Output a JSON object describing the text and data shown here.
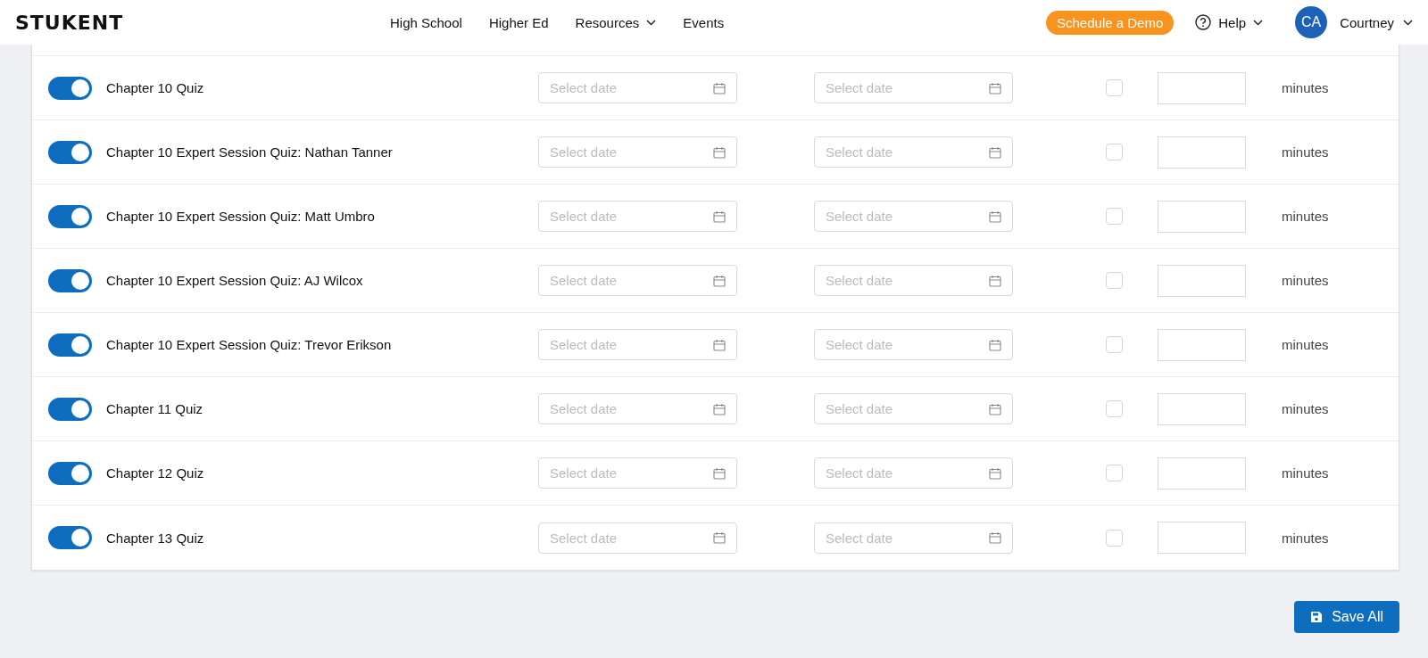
{
  "header": {
    "logo": "STUKENT",
    "nav": [
      {
        "label": "High School",
        "dropdown": false
      },
      {
        "label": "Higher Ed",
        "dropdown": false
      },
      {
        "label": "Resources",
        "dropdown": true
      },
      {
        "label": "Events",
        "dropdown": false
      }
    ],
    "demo_button": "Schedule a Demo",
    "help": "Help",
    "user": {
      "initials": "CA",
      "name": "Courtney"
    }
  },
  "rows": [
    {
      "title": "Chapter 10 Quiz",
      "on": true,
      "start_placeholder": "Select date",
      "end_placeholder": "Select date",
      "checked": false,
      "unit": "minutes"
    },
    {
      "title": "Chapter 10 Expert Session Quiz: Nathan Tanner",
      "on": true,
      "start_placeholder": "Select date",
      "end_placeholder": "Select date",
      "checked": false,
      "unit": "minutes"
    },
    {
      "title": "Chapter 10 Expert Session Quiz: Matt Umbro",
      "on": true,
      "start_placeholder": "Select date",
      "end_placeholder": "Select date",
      "checked": false,
      "unit": "minutes"
    },
    {
      "title": "Chapter 10 Expert Session Quiz: AJ Wilcox",
      "on": true,
      "start_placeholder": "Select date",
      "end_placeholder": "Select date",
      "checked": false,
      "unit": "minutes"
    },
    {
      "title": "Chapter 10 Expert Session Quiz: Trevor Erikson",
      "on": true,
      "start_placeholder": "Select date",
      "end_placeholder": "Select date",
      "checked": false,
      "unit": "minutes"
    },
    {
      "title": "Chapter 11 Quiz",
      "on": true,
      "start_placeholder": "Select date",
      "end_placeholder": "Select date",
      "checked": false,
      "unit": "minutes"
    },
    {
      "title": "Chapter 12 Quiz",
      "on": true,
      "start_placeholder": "Select date",
      "end_placeholder": "Select date",
      "checked": false,
      "unit": "minutes"
    },
    {
      "title": "Chapter 13 Quiz",
      "on": true,
      "start_placeholder": "Select date",
      "end_placeholder": "Select date",
      "checked": false,
      "unit": "minutes"
    }
  ],
  "save_button": "Save All"
}
